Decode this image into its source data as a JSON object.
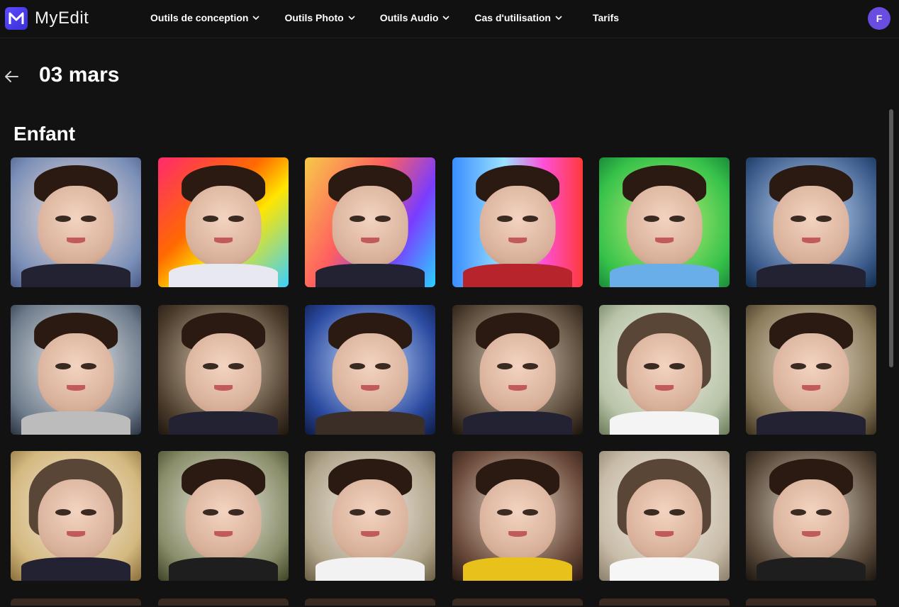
{
  "app": {
    "name": "MyEdit",
    "logo_letter": "M",
    "accent": "#5b4bff"
  },
  "nav": {
    "items": [
      {
        "label": "Outils de conception",
        "dropdown": true
      },
      {
        "label": "Outils Photo",
        "dropdown": true
      },
      {
        "label": "Outils Audio",
        "dropdown": true
      },
      {
        "label": "Cas d'utilisation",
        "dropdown": true
      },
      {
        "label": "Tarifs",
        "dropdown": false
      }
    ],
    "user_initial": "F"
  },
  "header": {
    "title": "03 mars",
    "back_icon": "arrow-left-icon"
  },
  "section": {
    "title": "Enfant"
  },
  "gallery": {
    "images": [
      "avatar-1",
      "avatar-2",
      "avatar-3",
      "avatar-4",
      "avatar-5",
      "avatar-6",
      "avatar-7",
      "avatar-8",
      "avatar-9",
      "avatar-10",
      "avatar-11",
      "avatar-12",
      "avatar-13",
      "avatar-14",
      "avatar-15",
      "avatar-16",
      "avatar-17",
      "avatar-18"
    ]
  }
}
